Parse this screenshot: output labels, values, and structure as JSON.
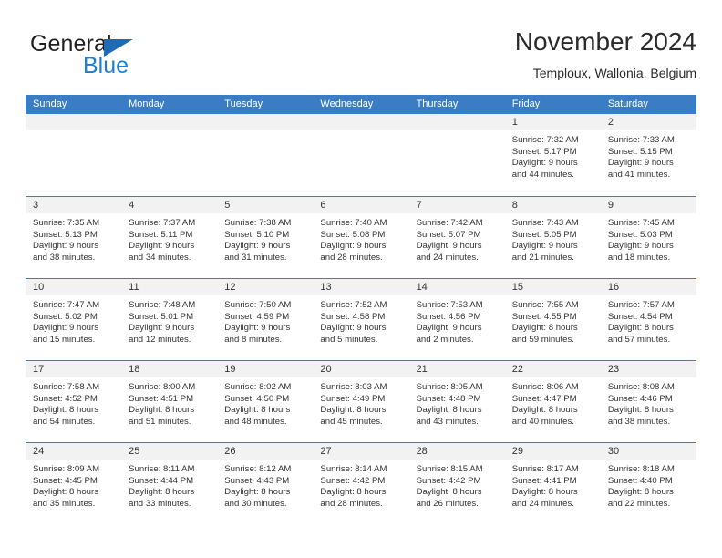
{
  "brand": {
    "name_part1": "General",
    "name_part2": "Blue",
    "triangle_color": "#1c6cb5",
    "blue_color": "#1b7fd4"
  },
  "header": {
    "title": "November 2024",
    "location": "Temploux, Wallonia, Belgium"
  },
  "theme": {
    "header_blue": "#3b7dc4",
    "daynum_band": "#f2f2f2",
    "text": "#333333"
  },
  "weekdays": [
    "Sunday",
    "Monday",
    "Tuesday",
    "Wednesday",
    "Thursday",
    "Friday",
    "Saturday"
  ],
  "weeks": [
    [
      {
        "day": "",
        "lines": []
      },
      {
        "day": "",
        "lines": []
      },
      {
        "day": "",
        "lines": []
      },
      {
        "day": "",
        "lines": []
      },
      {
        "day": "",
        "lines": []
      },
      {
        "day": "1",
        "lines": [
          "Sunrise: 7:32 AM",
          "Sunset: 5:17 PM",
          "Daylight: 9 hours",
          "and 44 minutes."
        ]
      },
      {
        "day": "2",
        "lines": [
          "Sunrise: 7:33 AM",
          "Sunset: 5:15 PM",
          "Daylight: 9 hours",
          "and 41 minutes."
        ]
      }
    ],
    [
      {
        "day": "3",
        "lines": [
          "Sunrise: 7:35 AM",
          "Sunset: 5:13 PM",
          "Daylight: 9 hours",
          "and 38 minutes."
        ]
      },
      {
        "day": "4",
        "lines": [
          "Sunrise: 7:37 AM",
          "Sunset: 5:11 PM",
          "Daylight: 9 hours",
          "and 34 minutes."
        ]
      },
      {
        "day": "5",
        "lines": [
          "Sunrise: 7:38 AM",
          "Sunset: 5:10 PM",
          "Daylight: 9 hours",
          "and 31 minutes."
        ]
      },
      {
        "day": "6",
        "lines": [
          "Sunrise: 7:40 AM",
          "Sunset: 5:08 PM",
          "Daylight: 9 hours",
          "and 28 minutes."
        ]
      },
      {
        "day": "7",
        "lines": [
          "Sunrise: 7:42 AM",
          "Sunset: 5:07 PM",
          "Daylight: 9 hours",
          "and 24 minutes."
        ]
      },
      {
        "day": "8",
        "lines": [
          "Sunrise: 7:43 AM",
          "Sunset: 5:05 PM",
          "Daylight: 9 hours",
          "and 21 minutes."
        ]
      },
      {
        "day": "9",
        "lines": [
          "Sunrise: 7:45 AM",
          "Sunset: 5:03 PM",
          "Daylight: 9 hours",
          "and 18 minutes."
        ]
      }
    ],
    [
      {
        "day": "10",
        "lines": [
          "Sunrise: 7:47 AM",
          "Sunset: 5:02 PM",
          "Daylight: 9 hours",
          "and 15 minutes."
        ]
      },
      {
        "day": "11",
        "lines": [
          "Sunrise: 7:48 AM",
          "Sunset: 5:01 PM",
          "Daylight: 9 hours",
          "and 12 minutes."
        ]
      },
      {
        "day": "12",
        "lines": [
          "Sunrise: 7:50 AM",
          "Sunset: 4:59 PM",
          "Daylight: 9 hours",
          "and 8 minutes."
        ]
      },
      {
        "day": "13",
        "lines": [
          "Sunrise: 7:52 AM",
          "Sunset: 4:58 PM",
          "Daylight: 9 hours",
          "and 5 minutes."
        ]
      },
      {
        "day": "14",
        "lines": [
          "Sunrise: 7:53 AM",
          "Sunset: 4:56 PM",
          "Daylight: 9 hours",
          "and 2 minutes."
        ]
      },
      {
        "day": "15",
        "lines": [
          "Sunrise: 7:55 AM",
          "Sunset: 4:55 PM",
          "Daylight: 8 hours",
          "and 59 minutes."
        ]
      },
      {
        "day": "16",
        "lines": [
          "Sunrise: 7:57 AM",
          "Sunset: 4:54 PM",
          "Daylight: 8 hours",
          "and 57 minutes."
        ]
      }
    ],
    [
      {
        "day": "17",
        "lines": [
          "Sunrise: 7:58 AM",
          "Sunset: 4:52 PM",
          "Daylight: 8 hours",
          "and 54 minutes."
        ]
      },
      {
        "day": "18",
        "lines": [
          "Sunrise: 8:00 AM",
          "Sunset: 4:51 PM",
          "Daylight: 8 hours",
          "and 51 minutes."
        ]
      },
      {
        "day": "19",
        "lines": [
          "Sunrise: 8:02 AM",
          "Sunset: 4:50 PM",
          "Daylight: 8 hours",
          "and 48 minutes."
        ]
      },
      {
        "day": "20",
        "lines": [
          "Sunrise: 8:03 AM",
          "Sunset: 4:49 PM",
          "Daylight: 8 hours",
          "and 45 minutes."
        ]
      },
      {
        "day": "21",
        "lines": [
          "Sunrise: 8:05 AM",
          "Sunset: 4:48 PM",
          "Daylight: 8 hours",
          "and 43 minutes."
        ]
      },
      {
        "day": "22",
        "lines": [
          "Sunrise: 8:06 AM",
          "Sunset: 4:47 PM",
          "Daylight: 8 hours",
          "and 40 minutes."
        ]
      },
      {
        "day": "23",
        "lines": [
          "Sunrise: 8:08 AM",
          "Sunset: 4:46 PM",
          "Daylight: 8 hours",
          "and 38 minutes."
        ]
      }
    ],
    [
      {
        "day": "24",
        "lines": [
          "Sunrise: 8:09 AM",
          "Sunset: 4:45 PM",
          "Daylight: 8 hours",
          "and 35 minutes."
        ]
      },
      {
        "day": "25",
        "lines": [
          "Sunrise: 8:11 AM",
          "Sunset: 4:44 PM",
          "Daylight: 8 hours",
          "and 33 minutes."
        ]
      },
      {
        "day": "26",
        "lines": [
          "Sunrise: 8:12 AM",
          "Sunset: 4:43 PM",
          "Daylight: 8 hours",
          "and 30 minutes."
        ]
      },
      {
        "day": "27",
        "lines": [
          "Sunrise: 8:14 AM",
          "Sunset: 4:42 PM",
          "Daylight: 8 hours",
          "and 28 minutes."
        ]
      },
      {
        "day": "28",
        "lines": [
          "Sunrise: 8:15 AM",
          "Sunset: 4:42 PM",
          "Daylight: 8 hours",
          "and 26 minutes."
        ]
      },
      {
        "day": "29",
        "lines": [
          "Sunrise: 8:17 AM",
          "Sunset: 4:41 PM",
          "Daylight: 8 hours",
          "and 24 minutes."
        ]
      },
      {
        "day": "30",
        "lines": [
          "Sunrise: 8:18 AM",
          "Sunset: 4:40 PM",
          "Daylight: 8 hours",
          "and 22 minutes."
        ]
      }
    ]
  ]
}
